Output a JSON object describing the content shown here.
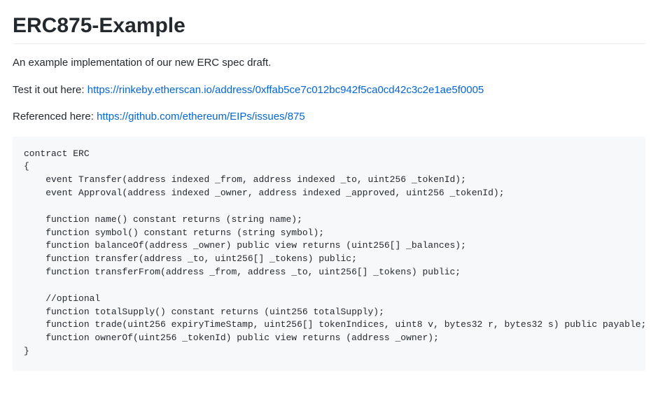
{
  "title": "ERC875-Example",
  "description": "An example implementation of our new ERC spec draft.",
  "test_prefix": "Test it out here: ",
  "test_link": "https://rinkeby.etherscan.io/address/0xffab5ce7c012bc942f5ca0cd42c3c2e1ae5f0005",
  "reference_prefix": "Referenced here: ",
  "reference_link": "https://github.com/ethereum/EIPs/issues/875",
  "code": "contract ERC\n{\n    event Transfer(address indexed _from, address indexed _to, uint256 _tokenId);\n    event Approval(address indexed _owner, address indexed _approved, uint256 _tokenId);\n\n    function name() constant returns (string name);\n    function symbol() constant returns (string symbol);\n    function balanceOf(address _owner) public view returns (uint256[] _balances);\n    function transfer(address _to, uint256[] _tokens) public;\n    function transferFrom(address _from, address _to, uint256[] _tokens) public;\n\n    //optional\n    function totalSupply() constant returns (uint256 totalSupply);\n    function trade(uint256 expiryTimeStamp, uint256[] tokenIndices, uint8 v, bytes32 r, bytes32 s) public payable;\n    function ownerOf(uint256 _tokenId) public view returns (address _owner);\n}"
}
